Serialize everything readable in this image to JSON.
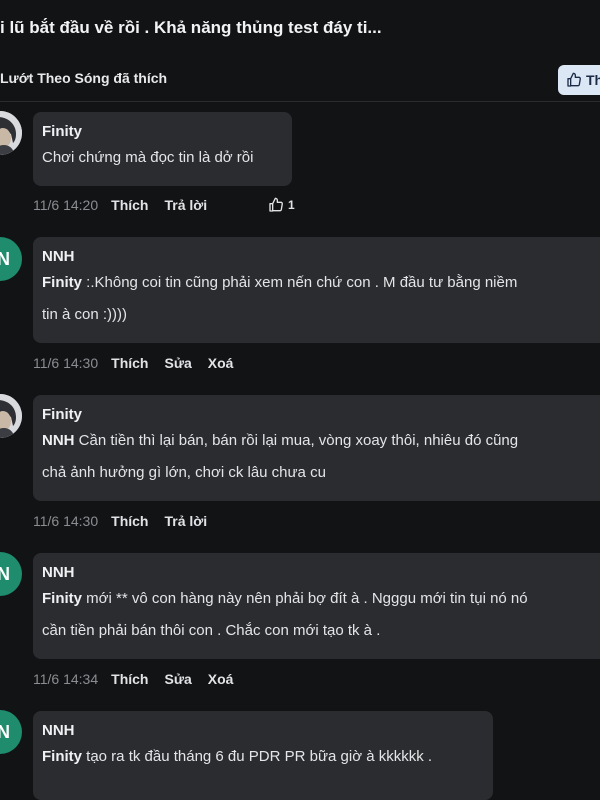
{
  "post": {
    "title": "i lũ bắt đầu về rồi . Khả năng thủng test đáy ti...",
    "liked_by": "Lướt Theo Sóng đã thích",
    "like_button_label": "Th"
  },
  "comments": [
    {
      "author": "Finity",
      "avatar": "photo",
      "mention": "",
      "text": "Chơi chứng mà đọc tin là dở rồi",
      "time": "11/6 14:20",
      "actions": [
        "Thích",
        "Trả lời"
      ],
      "likes": "1"
    },
    {
      "author": "NNH",
      "avatar_letter": "N",
      "mention": "Finity",
      "text_line1": " :.Không coi tin cũng phải xem nến chứ con . M đầu tư bằng niềm",
      "text_line2": "tin à con :))))",
      "time": "11/6 14:30",
      "actions": [
        "Thích",
        "Sửa",
        "Xoá"
      ]
    },
    {
      "author": "Finity",
      "avatar": "photo",
      "mention": "NNH",
      "text_line1": " Cần tiền thì lại bán, bán rồi lại mua, vòng xoay thôi, nhiêu đó cũng",
      "text_line2": "chả ảnh hưởng gì lớn, chơi ck lâu chưa cu",
      "time": "11/6 14:30",
      "actions": [
        "Thích",
        "Trả lời"
      ]
    },
    {
      "author": "NNH",
      "avatar_letter": "N",
      "mention": "Finity",
      "text_line1": " mới ** vô con hàng này nên phải bợ đít à . Ngggu mới tin tụi nó nó",
      "text_line2": "cần tiền phải bán thôi con . Chắc con mới tạo tk à .",
      "time": "11/6 14:34",
      "actions": [
        "Thích",
        "Sửa",
        "Xoá"
      ]
    },
    {
      "author": "NNH",
      "avatar_letter": "N",
      "mention": "Finity",
      "text": " tạo ra tk đầu tháng 6 đu PDR PR bữa giờ à kkkkkk ."
    }
  ]
}
